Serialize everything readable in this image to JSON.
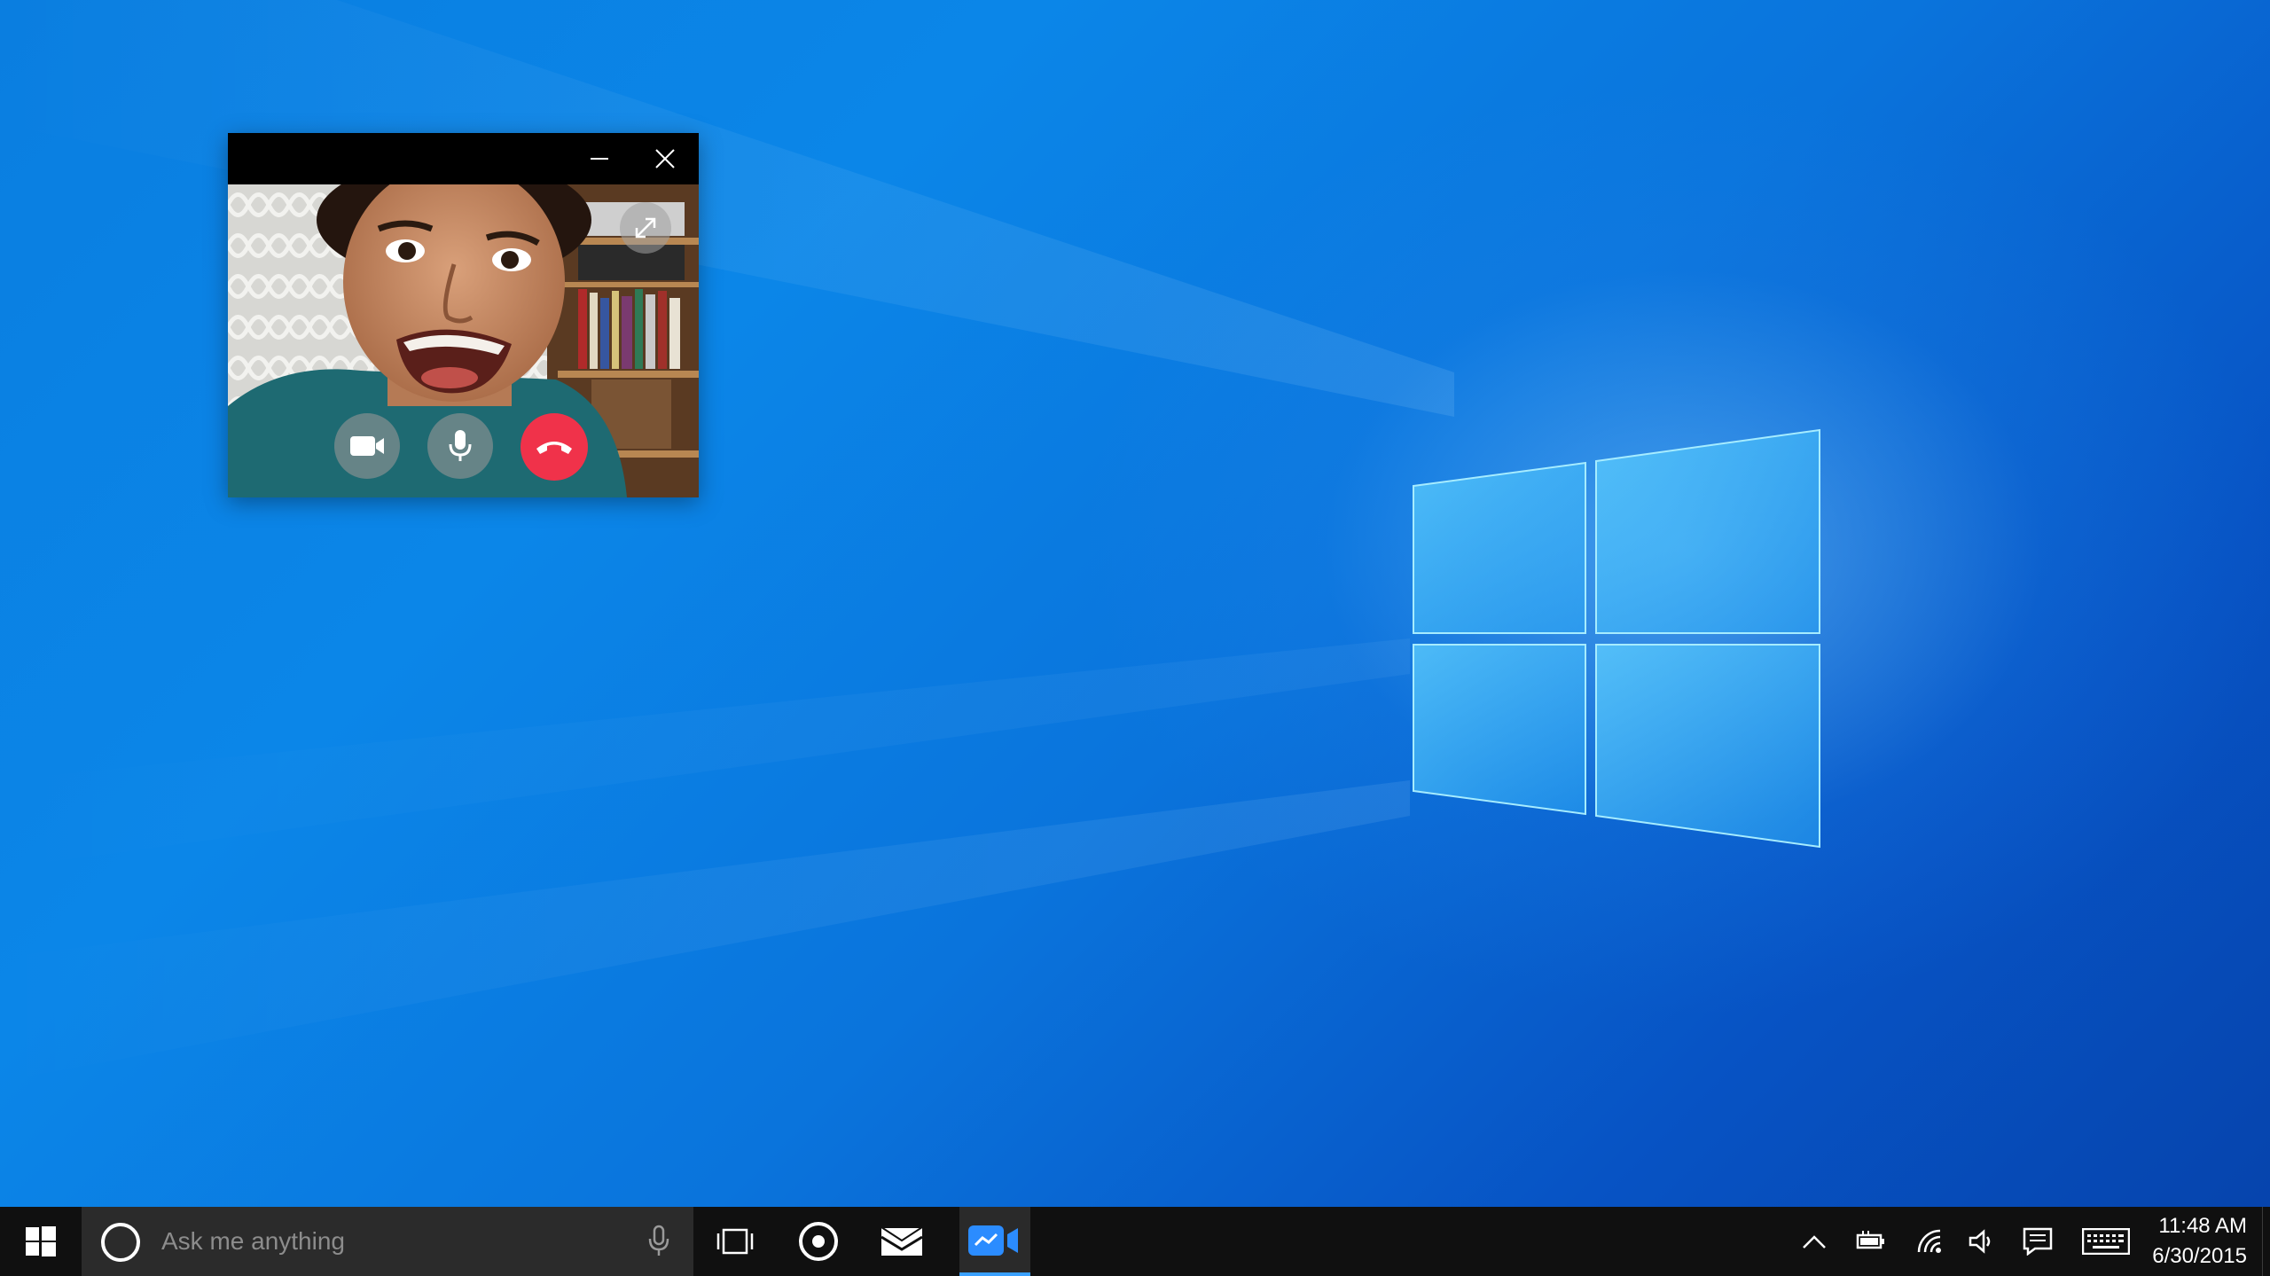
{
  "window": {
    "minimize_icon": "minimize-icon",
    "close_icon": "close-icon",
    "expand_icon": "expand-icon",
    "controls": {
      "camera_icon": "video-camera-icon",
      "mic_icon": "microphone-icon",
      "end_call_icon": "hang-up-icon"
    }
  },
  "taskbar": {
    "search": {
      "placeholder": "Ask me anything"
    },
    "apps": [
      "task-view-icon",
      "groove-music-icon",
      "mail-icon",
      "messaging-video-icon"
    ],
    "tray": {
      "time": "11:48 AM",
      "date": "6/30/2015"
    }
  },
  "colors": {
    "end_call": "#f0324a",
    "taskbar": "#101010",
    "search_box": "#2b2b2b",
    "accent": "#3aa0ff"
  }
}
